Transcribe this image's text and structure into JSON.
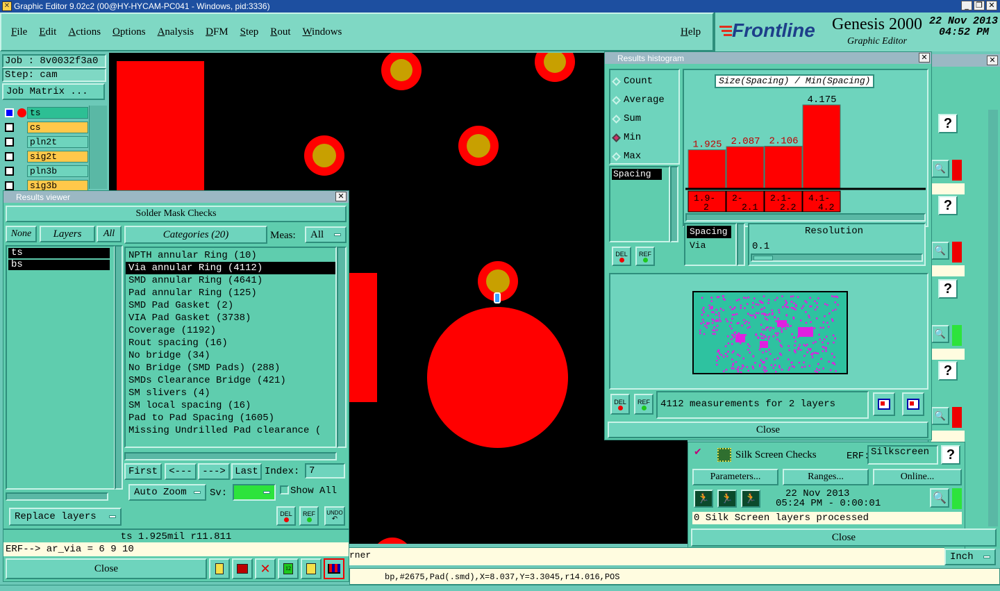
{
  "window_title": "Graphic Editor 9.02c2 (00@HY-HYCAM-PC041 - Windows, pid:3336)",
  "menu": [
    "File",
    "Edit",
    "Actions",
    "Options",
    "Analysis",
    "DFM",
    "Step",
    "Rout",
    "Windows"
  ],
  "help": "Help",
  "brand": {
    "logo": "Frontline",
    "product": "Genesis 2000",
    "subtitle": "Graphic Editor",
    "date": "22 Nov 2013",
    "time": "04:52 PM"
  },
  "job": {
    "job": "Job : 8v0032f3a0",
    "step": "Step: cam",
    "matrix_btn": "Job Matrix ..."
  },
  "layers": [
    {
      "name": "ts",
      "color": "#2dbf94",
      "active": true
    },
    {
      "name": "cs",
      "color": "#ffc84a"
    },
    {
      "name": "pln2t",
      "color": "#6ed4bd"
    },
    {
      "name": "sig2t",
      "color": "#ffc84a"
    },
    {
      "name": "pln3b",
      "color": "#6ed4bd"
    },
    {
      "name": "sig3b",
      "color": "#ffc84a"
    }
  ],
  "results_viewer": {
    "title": "Results viewer",
    "header": "Solder Mask Checks",
    "none": "None",
    "layers": "Layers",
    "all": "All",
    "layer_list": [
      "ts",
      "bs"
    ],
    "categories_btn": "Categories (20)",
    "meas_label": "Meas:",
    "meas_value": "All",
    "categories": [
      "NPTH annular Ring (10)",
      "Via annular Ring (4112)",
      "SMD annular Ring (4641)",
      "Pad annular Ring (125)",
      "SMD Pad Gasket (2)",
      "VIA Pad Gasket (3738)",
      "Coverage (1192)",
      "Rout spacing (16)",
      "No bridge (34)",
      "No Bridge (SMD Pads) (288)",
      "SMDs Clearance Bridge (421)",
      "SM slivers (4)",
      "SM local spacing (16)",
      "Pad to Pad Spacing (1605)",
      "Missing Undrilled Pad clearance ("
    ],
    "selected_index": 1,
    "nav": {
      "first": "First",
      "prev": "<---",
      "next": "--->",
      "last": "Last",
      "index_label": "Index:",
      "index_value": "7"
    },
    "auto_zoom": "Auto Zoom",
    "sv_label": "Sv:",
    "show_all": "Show All",
    "replace_layers": "Replace layers",
    "del": "DEL",
    "ref": "REF",
    "undo": "UNDO",
    "status": "ts 1.925mil  r11.811",
    "erf": "ERF--> ar_via = 6 9 10",
    "close": "Close"
  },
  "histogram": {
    "title": "Results histogram",
    "modes": [
      "Count",
      "Average",
      "Sum",
      "Min",
      "Max"
    ],
    "selected_mode": "Min",
    "chart_title": "Size(Spacing) / Min(Spacing)",
    "list_item": "Spacing",
    "del": "DEL",
    "ref": "REF",
    "bottom_list": [
      "Spacing",
      "Via"
    ],
    "resolution_label": "Resolution",
    "resolution_value": "0.1",
    "summary": "4112 measurements for 2 layers",
    "close": "Close"
  },
  "chart_data": {
    "type": "bar",
    "title": "Size(Spacing) / Min(Spacing)",
    "categories": [
      "1.9-2",
      "2-2.1",
      "2.1-2.2",
      "4.1-4.2"
    ],
    "category_lines": [
      [
        "1.9-",
        "2"
      ],
      [
        "2-",
        "2.1"
      ],
      [
        "2.1-",
        "2.2"
      ],
      [
        "4.1-",
        "4.2"
      ]
    ],
    "values": [
      1.925,
      2.087,
      2.106,
      4.175
    ],
    "value_labels": [
      "1.925",
      "2.087",
      "2.106",
      "4.175"
    ],
    "ylim": [
      0,
      4.175
    ],
    "color": "#ff0000"
  },
  "silk": {
    "name": "Silk Screen Checks",
    "erf_label": "ERF:",
    "erf_value": "Silkscreen",
    "parameters": "Parameters...",
    "ranges": "Ranges...",
    "online": "Online...",
    "date": "22 Nov 2013",
    "time": "05:24 PM - 0:00:01",
    "status": "0 Silk Screen layers processed",
    "close": "Close"
  },
  "bottom": {
    "cursor_text": "rner",
    "units": "Inch",
    "feature_info": "bp,#2675,Pad(.smd),X=8.037,Y=3.3045,r14.016,POS"
  },
  "canvas_colors": {
    "background": "#000000",
    "copper": "#ff0000",
    "drill": "#c8a000"
  }
}
